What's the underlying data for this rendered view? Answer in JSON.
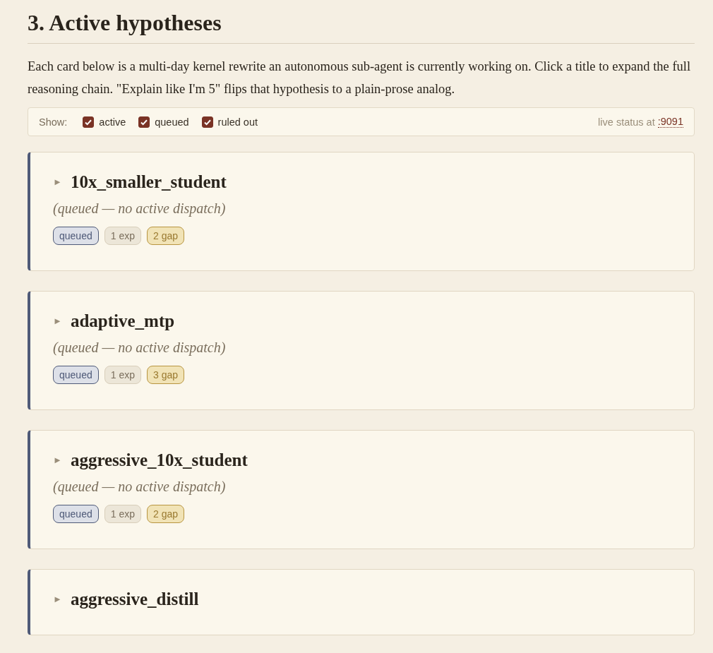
{
  "heading": "3. Active hypotheses",
  "intro": "Each card below is a multi-day kernel rewrite an autonomous sub-agent is currently working on. Click a title to expand the full reasoning chain. \"Explain like I'm 5\" flips that hypothesis to a plain-prose analog.",
  "filter_bar": {
    "label": "Show:",
    "filters": [
      {
        "label": "active",
        "checked": true
      },
      {
        "label": "queued",
        "checked": true
      },
      {
        "label": "ruled out",
        "checked": true
      }
    ],
    "status_text": "live status at",
    "status_link": ":9091"
  },
  "cards": [
    {
      "toggle": "►",
      "title": "10x_smaller_student",
      "expanded": false,
      "status_note": "(queued — no active dispatch)",
      "badges": [
        {
          "kind": "status",
          "label": "queued"
        },
        {
          "kind": "exp",
          "label": "1 exp"
        },
        {
          "kind": "gap",
          "label": "2 gap"
        }
      ]
    },
    {
      "toggle": "►",
      "title": "adaptive_mtp",
      "expanded": false,
      "status_note": "(queued — no active dispatch)",
      "badges": [
        {
          "kind": "status",
          "label": "queued"
        },
        {
          "kind": "exp",
          "label": "1 exp"
        },
        {
          "kind": "gap",
          "label": "3 gap"
        }
      ]
    },
    {
      "toggle": "►",
      "title": "aggressive_10x_student",
      "expanded": false,
      "status_note": "(queued — no active dispatch)",
      "badges": [
        {
          "kind": "status",
          "label": "queued"
        },
        {
          "kind": "exp",
          "label": "1 exp"
        },
        {
          "kind": "gap",
          "label": "2 gap"
        }
      ]
    },
    {
      "toggle": "►",
      "title": "aggressive_distill",
      "expanded": false
    }
  ]
}
